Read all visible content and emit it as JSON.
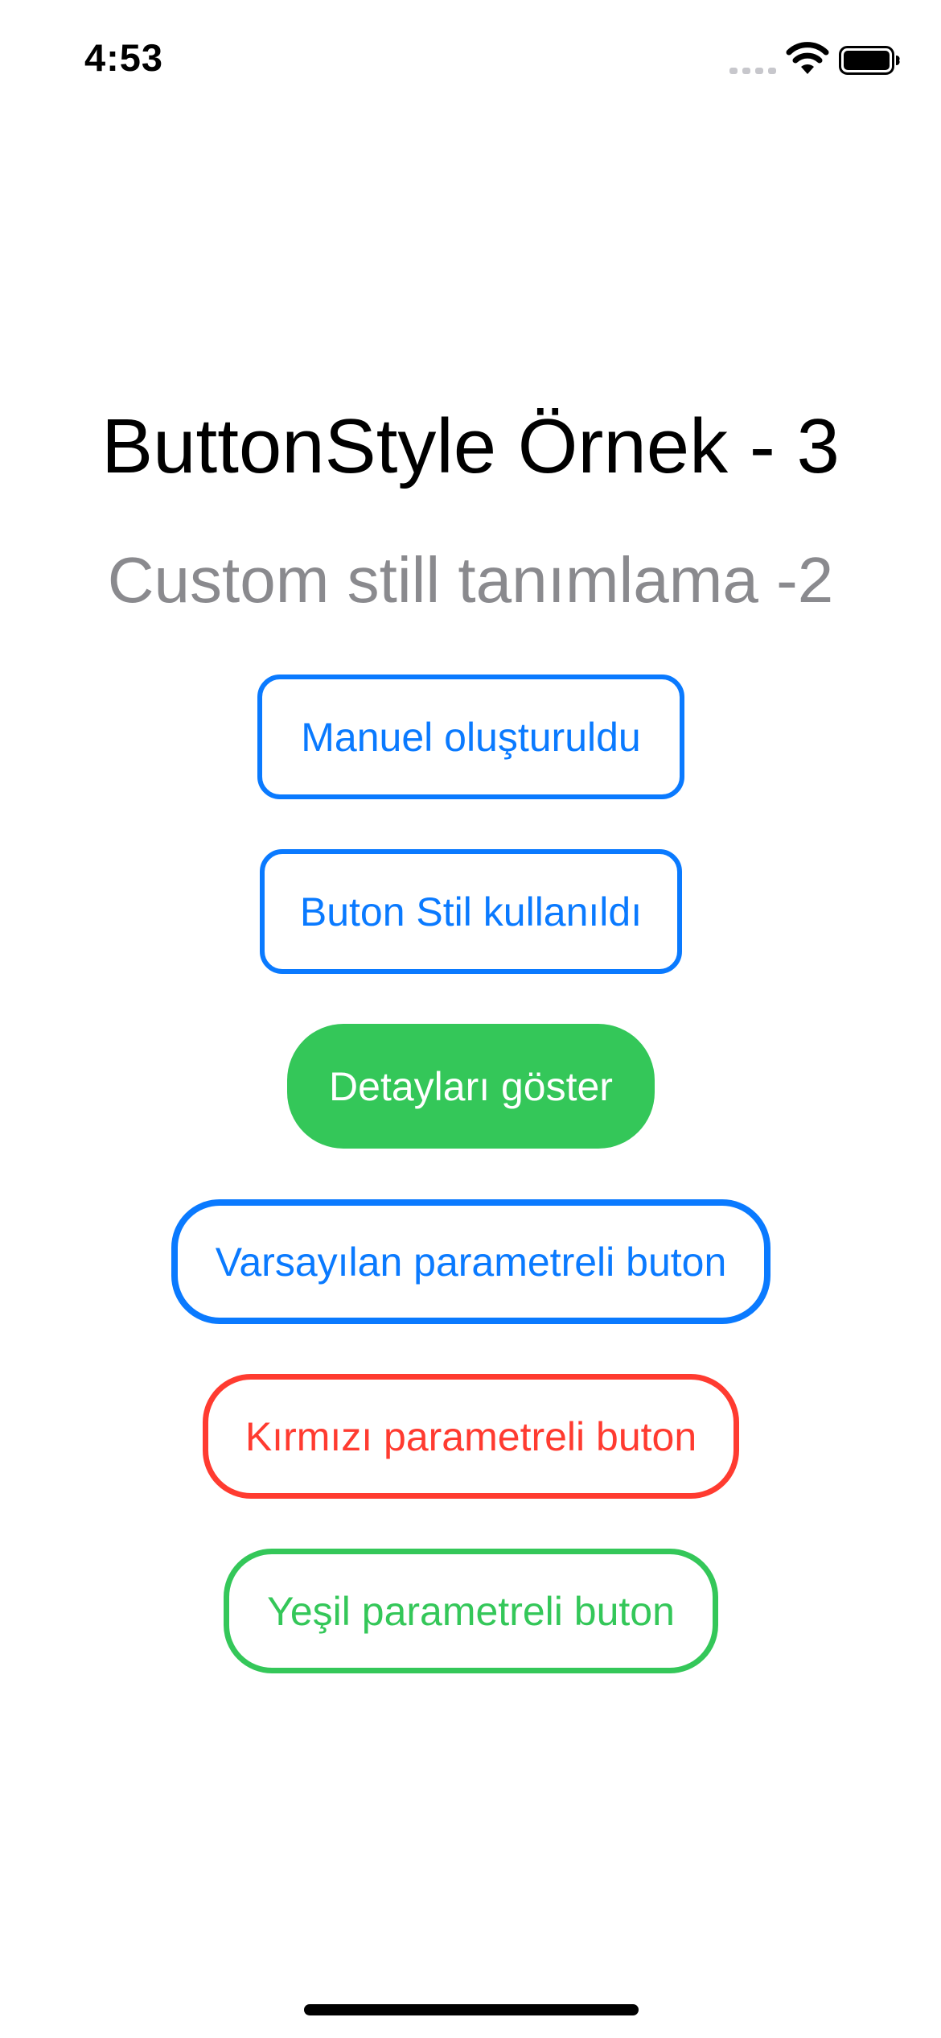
{
  "status_bar": {
    "time": "4:53",
    "signal_icon": "cellular-signal-icon",
    "wifi_icon": "wifi-icon",
    "battery_icon": "battery-full-icon"
  },
  "screen": {
    "title": "ButtonStyle Örnek - 3",
    "subtitle": "Custom still tanımlama -2"
  },
  "buttons": {
    "manual": "Manuel oluşturuldu",
    "style_used": "Buton Stil kullanıldı",
    "show_details": "Detayları göster",
    "default_param": "Varsayılan parametreli buton",
    "red_param": "Kırmızı parametreli buton",
    "green_param": "Yeşil parametreli buton"
  },
  "colors": {
    "blue": "#0a7aff",
    "green": "#34c759",
    "red": "#ff3b30",
    "subtitle_gray": "#8a8a8e"
  }
}
